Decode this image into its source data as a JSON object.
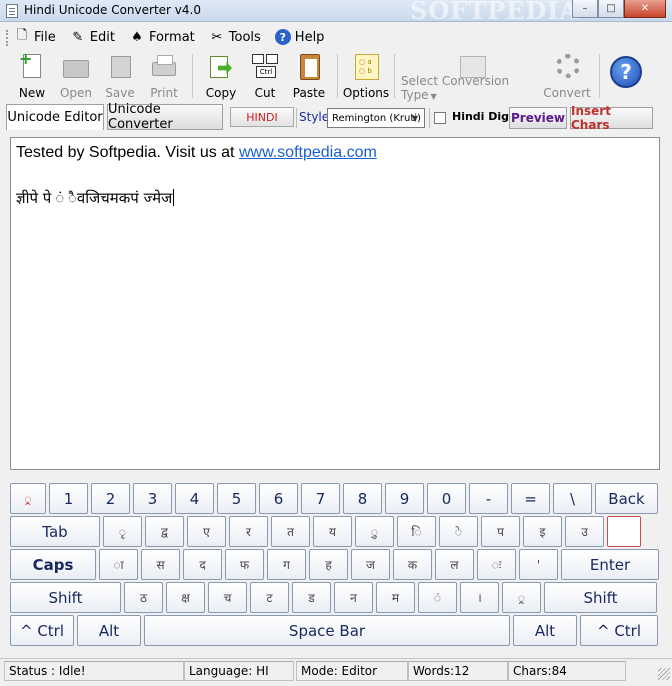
{
  "window": {
    "title": "Hindi Unicode Converter v4.0",
    "watermark": "SOFTPEDIA",
    "controls": [
      "–",
      "□",
      "✕"
    ]
  },
  "menu": [
    {
      "label": "File",
      "icon": "file-icon"
    },
    {
      "label": "Edit",
      "icon": "edit-icon"
    },
    {
      "label": "Format",
      "icon": "format-icon"
    },
    {
      "label": "Tools",
      "icon": "tools-icon"
    },
    {
      "label": "Help",
      "icon": "help-icon"
    }
  ],
  "toolbar": {
    "new": "New",
    "open": "Open",
    "save": "Save",
    "print": "Print",
    "copy": "Copy",
    "cut": "Cut",
    "paste": "Paste",
    "options": "Options",
    "conversion_type": "Select Conversion Type",
    "convert": "Convert",
    "help_glyph": "?"
  },
  "tabs": {
    "editor": "Unicode Editor",
    "converter": "Unicode Converter"
  },
  "options_row": {
    "hindi_button": "HINDI",
    "style_label": "Style",
    "style_value": "Remington (Kruti)",
    "hindi_digit_label": "Hindi Digit",
    "hindi_digit_checked": false,
    "preview": "Preview",
    "insert_chars": "Insert Chars"
  },
  "editor": {
    "line1_prefix": "Tested by Softpedia. Visit us at ",
    "line1_link": "www.softpedia.com",
    "line2": "ज्ञीपे पे ं ैवजिचमकपं ज्मेज"
  },
  "keyboard": {
    "row1": [
      "्र",
      "1",
      "2",
      "3",
      "4",
      "5",
      "6",
      "7",
      "8",
      "9",
      "0",
      "-",
      "=",
      "\\",
      "Back"
    ],
    "row2": [
      "Tab",
      "ृ",
      "द्व",
      "ए",
      "र",
      "त",
      "य",
      "ु",
      "ि",
      "े",
      "प",
      "इ",
      "उ",
      ""
    ],
    "row3": [
      "Caps",
      "ा",
      "स",
      "द",
      "फ",
      "ग",
      "ह",
      "ज",
      "क",
      "ल",
      "ः",
      "'",
      "Enter"
    ],
    "row4": [
      "Shift",
      "ठ",
      "क्ष",
      "च",
      "ट",
      "ड",
      "न",
      "म",
      "ं",
      "।",
      "्र",
      "Shift"
    ],
    "row5": [
      "^ Ctrl",
      "Alt",
      "Space Bar",
      "Alt",
      "^ Ctrl"
    ]
  },
  "status": {
    "status": "Status :  Idle!",
    "language": "Language: HI",
    "mode": "Mode: Editor",
    "words": "Words:12",
    "chars": "Chars:84"
  }
}
